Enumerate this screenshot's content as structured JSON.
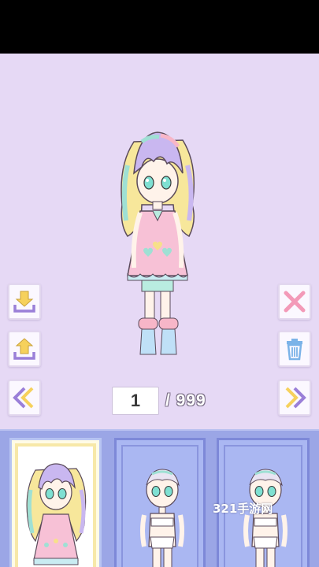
{
  "counter": {
    "current": "1",
    "total": "/ 999"
  },
  "watermark": "321手游网",
  "colors": {
    "stage_bg": "#e6d9f5",
    "tray_bg": "#9ba6e6",
    "selected_slot_border": "#f7e8a8",
    "arrow_yellow": "#f6d15c",
    "arrow_purple": "#9a7fd8",
    "delete_pink": "#f39ab8",
    "trash_blue": "#7bb3e8"
  },
  "left_buttons": [
    {
      "name": "download-icon"
    },
    {
      "name": "upload-icon"
    },
    {
      "name": "previous-icon"
    }
  ],
  "right_buttons": [
    {
      "name": "close-icon"
    },
    {
      "name": "trash-icon"
    },
    {
      "name": "next-icon"
    }
  ],
  "slots": [
    {
      "state": "selected",
      "character": "pastel-rainbow-hair-girl-pink-dress"
    },
    {
      "state": "default",
      "character": "base-doll"
    },
    {
      "state": "default",
      "character": "base-doll"
    }
  ]
}
